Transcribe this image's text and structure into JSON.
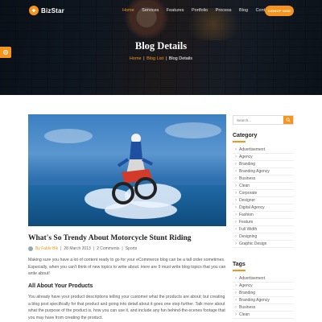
{
  "brand": {
    "name": "BizStar",
    "accent": "#f7941d"
  },
  "nav": {
    "items": [
      "Home",
      "Services",
      "Features",
      "Portfolio",
      "Process",
      "Blog",
      "Contact"
    ],
    "active": "Home",
    "cta_label": "SIGNUP NOW"
  },
  "hero": {
    "title": "Blog Details",
    "breadcrumb": [
      "Home",
      "Blog List",
      "Blog Details"
    ]
  },
  "post": {
    "title": "What's So Trendy About Motorcycle Stunt Riding",
    "author": "By Fable Blk",
    "date": "28 March 2013",
    "comments": "2 Comments",
    "category": "Sports",
    "paragraph1": "Making sure you have a lot of content ready to go for your eCommerce blog can be a tall order sometimes. Especially, when you can't think of new topics to write about. Here are 9 must write blog topics that you can write about!",
    "subheading": "All About Your Products",
    "paragraph2": "You already have your product descriptions telling your customer what the products are about; but creating a blog post specifically for that product and going into detail about it goes one step further. Talk more about what the purpose of the product is, how you can use it, and include any fun behind-the-scenes footage that you may have from creating the product."
  },
  "sidebar": {
    "search_placeholder": "Search...",
    "category_title": "Category",
    "categories": [
      "Advertisement",
      "Agency",
      "Branding",
      "Branding Agency",
      "Business",
      "Clean",
      "Corporate",
      "Designer",
      "Digital Agency",
      "Fashion",
      "Feature",
      "Full Width",
      "Designing",
      "Graphic Design"
    ],
    "tags_title": "Tags",
    "tags": [
      "Advertisement",
      "Agency",
      "Branding",
      "Branding Agency",
      "Business",
      "Clean"
    ]
  }
}
